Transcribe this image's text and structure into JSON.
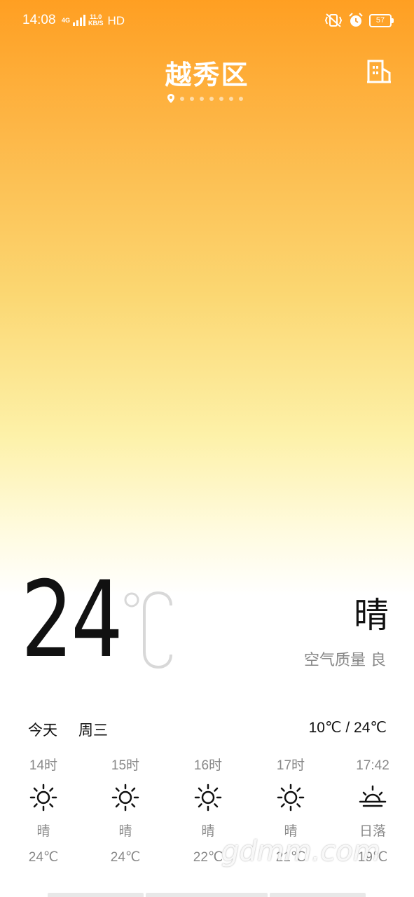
{
  "status_bar": {
    "time": "14:08",
    "network": "4G",
    "speed_value": "11.0",
    "speed_unit": "KB/S",
    "hd": "HD",
    "battery": "57"
  },
  "header": {
    "city": "越秀区",
    "page_count": 8,
    "current_page": 0
  },
  "current": {
    "temperature": "24",
    "condition": "晴",
    "air_quality": "空气质量 良"
  },
  "today": {
    "label": "今天",
    "weekday": "周三",
    "range": "10℃ / 24℃"
  },
  "hourly": [
    {
      "time": "14时",
      "icon": "sun-icon",
      "cond": "晴",
      "temp": "24℃"
    },
    {
      "time": "15时",
      "icon": "sun-icon",
      "cond": "晴",
      "temp": "24℃"
    },
    {
      "time": "16时",
      "icon": "sun-icon",
      "cond": "晴",
      "temp": "22℃"
    },
    {
      "time": "17时",
      "icon": "sun-icon",
      "cond": "晴",
      "temp": "21℃"
    },
    {
      "time": "17:42",
      "icon": "sunset-icon",
      "cond": "日落",
      "temp": "19℃"
    }
  ],
  "watermark": "gdmm.com",
  "colors": {
    "gradient_top": "#ff9f22",
    "gradient_mid": "#fbd772",
    "text_primary": "#111111",
    "text_secondary": "#888888"
  }
}
